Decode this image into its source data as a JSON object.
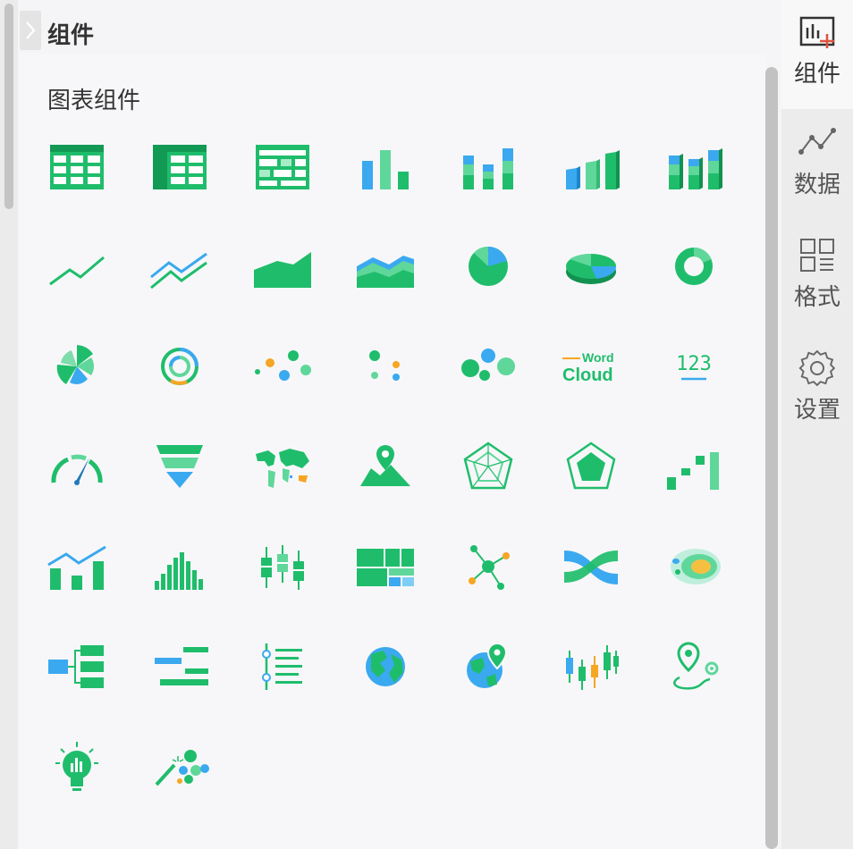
{
  "header": {
    "title": "组件"
  },
  "main": {
    "section_title": "图表组件"
  },
  "right_tabs": [
    {
      "label": "组件"
    },
    {
      "label": "数据"
    },
    {
      "label": "格式"
    },
    {
      "label": "设置"
    }
  ],
  "word_cloud": {
    "word": "Word",
    "cloud": "Cloud"
  },
  "number_icon": {
    "text": "123"
  },
  "colors": {
    "green": "#1fbd6b",
    "light_green": "#5fd79a",
    "blue": "#3aa9ef",
    "orange": "#f5a623"
  },
  "components": [
    "table-icon",
    "cross-table-icon",
    "grouped-table-icon",
    "bar-chart-icon",
    "stacked-bar-chart-icon",
    "3d-bar-chart-icon",
    "3d-stacked-bar-chart-icon",
    "line-chart-icon",
    "multi-line-chart-icon",
    "area-chart-icon",
    "stacked-area-chart-icon",
    "pie-chart-icon",
    "3d-pie-chart-icon",
    "donut-chart-icon",
    "rose-chart-icon",
    "multi-ring-chart-icon",
    "scatter-chart-icon",
    "dot-chart-icon",
    "bubble-chart-icon",
    "word-cloud-icon",
    "number-card-icon",
    "gauge-chart-icon",
    "funnel-chart-icon",
    "world-map-icon",
    "location-map-icon",
    "radar-chart-icon",
    "filled-radar-chart-icon",
    "waterfall-chart-icon",
    "combo-chart-icon",
    "histogram-icon",
    "box-plot-icon",
    "treemap-icon",
    "relation-graph-icon",
    "sankey-chart-icon",
    "heat-map-icon",
    "tree-chart-icon",
    "gantt-chart-icon",
    "timeline-icon",
    "globe-icon",
    "globe-marker-icon",
    "candlestick-chart-icon",
    "route-map-icon",
    "insight-bulb-icon",
    "smart-chart-icon"
  ]
}
